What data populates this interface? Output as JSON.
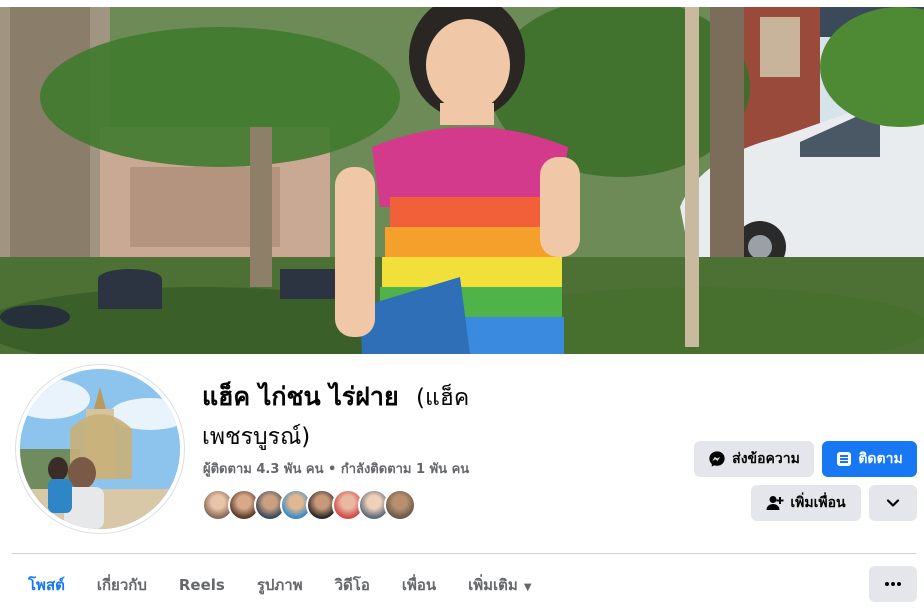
{
  "profile": {
    "name": "แฮ็ค ไก่ชน ไร่ฝาย",
    "alt_name": "(แฮ็ค เพชรบูรณ์)",
    "stats": "ผู้ติดตาม 4.3 พัน คน • กำลังติดตาม 1 พัน คน"
  },
  "actions": {
    "message_label": "ส่งข้อความ",
    "follow_label": "ติดตาม",
    "add_friend_label": "เพิ่มเพื่อน"
  },
  "tabs": [
    {
      "label": "โพสต์"
    },
    {
      "label": "เกี่ยวกับ"
    },
    {
      "label": "Reels"
    },
    {
      "label": "รูปภาพ"
    },
    {
      "label": "วิดีโอ"
    },
    {
      "label": "เพื่อน"
    },
    {
      "label": "เพิ่มเติม"
    }
  ],
  "icons": {
    "messenger": "messenger-icon",
    "follow": "follow-icon",
    "add_friend": "add-friend-icon",
    "chevron": "chevron-down-icon",
    "more": "more-icon"
  },
  "colors": {
    "accent": "#1877f2",
    "button_grey": "#e4e6eb",
    "secondary_text": "#65676b"
  }
}
